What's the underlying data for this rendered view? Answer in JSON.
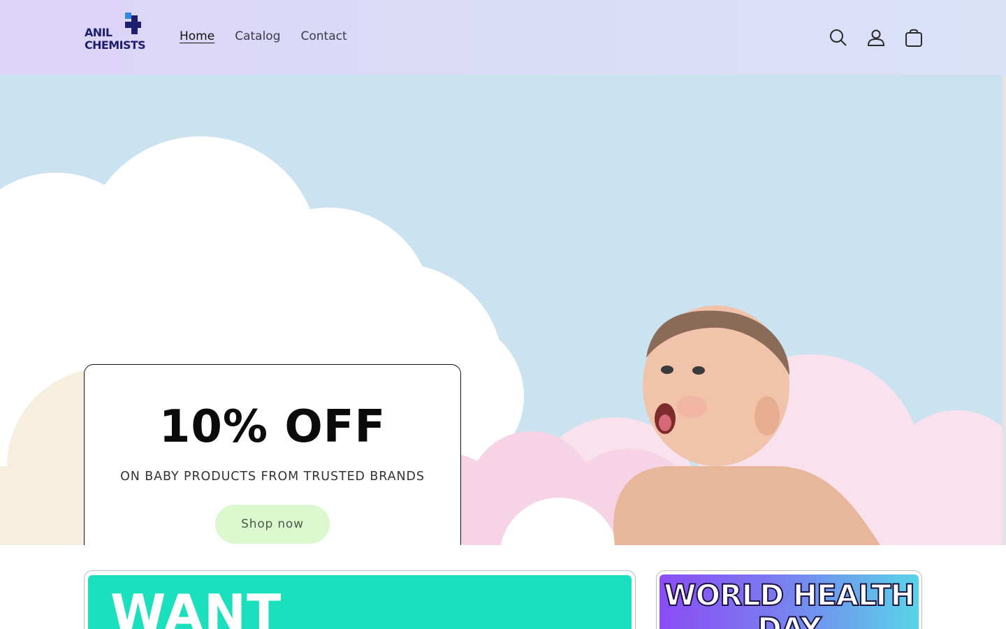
{
  "brand": {
    "line1": "ANIL",
    "line2": "CHEMISTS",
    "colors": {
      "primary": "#1d1f6e",
      "accent": "#2d6fd8"
    }
  },
  "nav": {
    "items": [
      {
        "label": "Home",
        "active": true
      },
      {
        "label": "Catalog",
        "active": false
      },
      {
        "label": "Contact",
        "active": false
      }
    ]
  },
  "header_icons": [
    "search-icon",
    "account-icon",
    "cart-icon"
  ],
  "hero": {
    "title": "10% OFF",
    "subtitle": "ON BABY PRODUCTS FROM TRUSTED BRANDS",
    "cta_label": "Shop now",
    "colors": {
      "sky": "#cbe2f1",
      "cloud_white": "#ffffff",
      "cloud_pink": "#f8dcea",
      "cloud_cream": "#f6efdf",
      "cta_bg": "#dbf8cf"
    }
  },
  "promo_cards": [
    {
      "text": "WANT",
      "bg": "#1be0bd"
    },
    {
      "text": "WORLD HEALTH DAY",
      "bg_from": "#8b4cf4",
      "bg_to": "#58d4e8"
    }
  ]
}
